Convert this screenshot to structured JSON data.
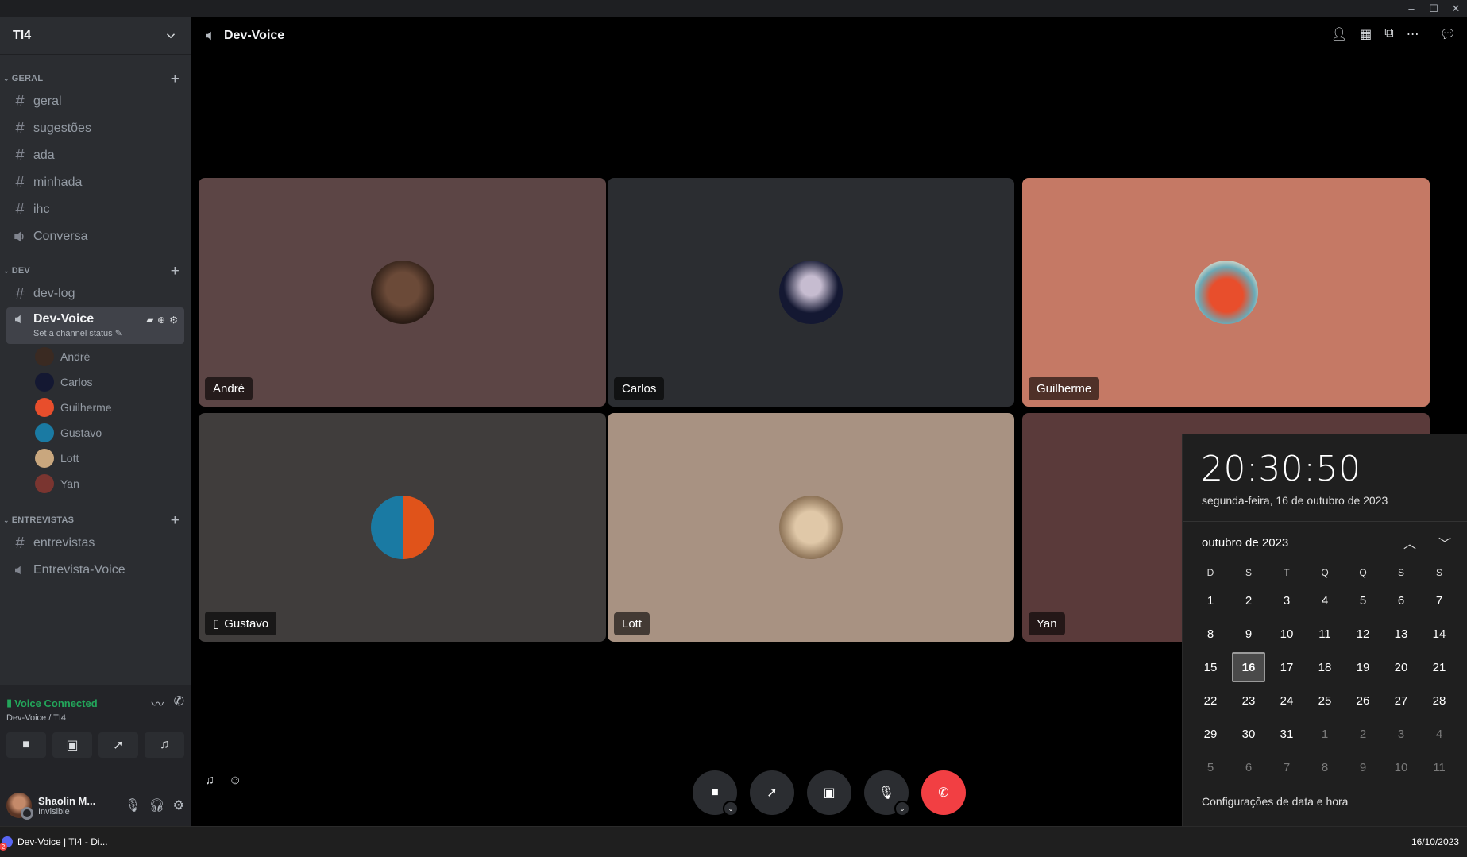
{
  "window": {
    "minimize": "–",
    "maximize": "☐",
    "close": "✕"
  },
  "server": {
    "name": "TI4"
  },
  "categories": [
    {
      "name": "GERAL",
      "channels": [
        {
          "type": "text",
          "name": "geral"
        },
        {
          "type": "text",
          "name": "sugestões"
        },
        {
          "type": "text",
          "name": "ada"
        },
        {
          "type": "text",
          "name": "minhada"
        },
        {
          "type": "text",
          "name": "ihc"
        },
        {
          "type": "voice",
          "name": "Conversa"
        }
      ]
    },
    {
      "name": "DEV",
      "channels": [
        {
          "type": "text",
          "name": "dev-log"
        }
      ]
    },
    {
      "name": "ENTREVISTAS",
      "channels": [
        {
          "type": "text",
          "name": "entrevistas"
        },
        {
          "type": "voice",
          "name": "Entrevista-Voice"
        }
      ]
    }
  ],
  "active_channel": {
    "name": "Dev-Voice",
    "status": "Set a channel status",
    "users": [
      "André",
      "Carlos",
      "Guilherme",
      "Gustavo",
      "Lott",
      "Yan"
    ]
  },
  "voice": {
    "title": "Voice Connected",
    "subtitle": "Dev-Voice / TI4"
  },
  "user": {
    "name": "Shaolin M...",
    "status": "Invisible"
  },
  "main": {
    "title": "Dev-Voice",
    "tiles": [
      {
        "name": "André",
        "bg": "#5c4545",
        "avatar": "#3a2a22"
      },
      {
        "name": "Carlos",
        "bg": "#2b2d31",
        "avatar": "#141832"
      },
      {
        "name": "Guilherme",
        "bg": "#c57965",
        "avatar": "#e84e2c"
      },
      {
        "name": "Gustavo",
        "bg": "#403d3c",
        "avatar": "#1a7aa3"
      },
      {
        "name": "Lott",
        "bg": "#a89282",
        "avatar": "#c9a77e"
      },
      {
        "name": "Yan",
        "bg": "#5a3a3a",
        "avatar": "#7a3530"
      }
    ]
  },
  "clock": {
    "time": "20:30:50",
    "date": "segunda-feira, 16 de outubro de 2023",
    "month": "outubro de 2023",
    "dow": [
      "D",
      "S",
      "T",
      "Q",
      "Q",
      "S",
      "S"
    ],
    "days": [
      [
        "1",
        "2",
        "3",
        "4",
        "5",
        "6",
        "7"
      ],
      [
        "8",
        "9",
        "10",
        "11",
        "12",
        "13",
        "14"
      ],
      [
        "15",
        "16",
        "17",
        "18",
        "19",
        "20",
        "21"
      ],
      [
        "22",
        "23",
        "24",
        "25",
        "26",
        "27",
        "28"
      ],
      [
        "29",
        "30",
        "31",
        "1",
        "2",
        "3",
        "4"
      ],
      [
        "5",
        "6",
        "7",
        "8",
        "9",
        "10",
        "11"
      ]
    ],
    "today": "16",
    "settings": "Configurações de data e hora"
  },
  "taskbar": {
    "app": "Dev-Voice | TI4 - Di...",
    "badge": "2",
    "date": "16/10/2023"
  }
}
